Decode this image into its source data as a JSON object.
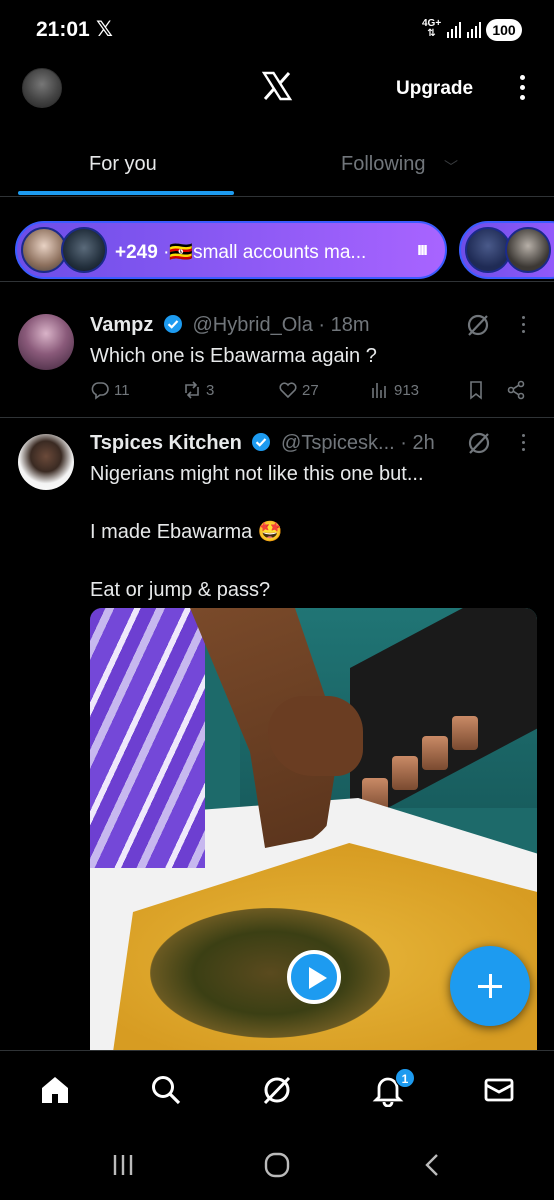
{
  "status_bar": {
    "time": "21:01",
    "x_glyph": "𝕏",
    "network": "4G+",
    "battery": "100"
  },
  "header": {
    "upgrade_label": "Upgrade",
    "logo": "x-logo"
  },
  "tabs": [
    {
      "label": "For you",
      "active": true
    },
    {
      "label": "Following",
      "active": false
    }
  ],
  "community_pill": {
    "count": "+249",
    "separator": "·",
    "flag": "🇺🇬",
    "name": "small accounts ma...",
    "dots": "ııı"
  },
  "posts": [
    {
      "name": "Vampz",
      "handle": "@Hybrid_Ola",
      "time": "· 18m",
      "text": [
        "Which one is Ebawarma again ?"
      ],
      "replies": "11",
      "reposts": "3",
      "likes": "27",
      "views": "913"
    },
    {
      "name": "Tspices Kitchen",
      "handle": "@Tspicesk...",
      "time": "· 2h",
      "text": [
        "Nigerians might not like this one but...",
        "",
        "I made Ebawarma 🤩",
        "",
        "Eat or  jump & pass?"
      ]
    }
  ],
  "bottom_nav": {
    "notifications_badge": "1"
  },
  "colors": {
    "accent": "#1d9bf0",
    "background": "#000000",
    "muted": "#71767b",
    "pill_start": "#6d4ee8",
    "pill_end": "#a864ff"
  }
}
